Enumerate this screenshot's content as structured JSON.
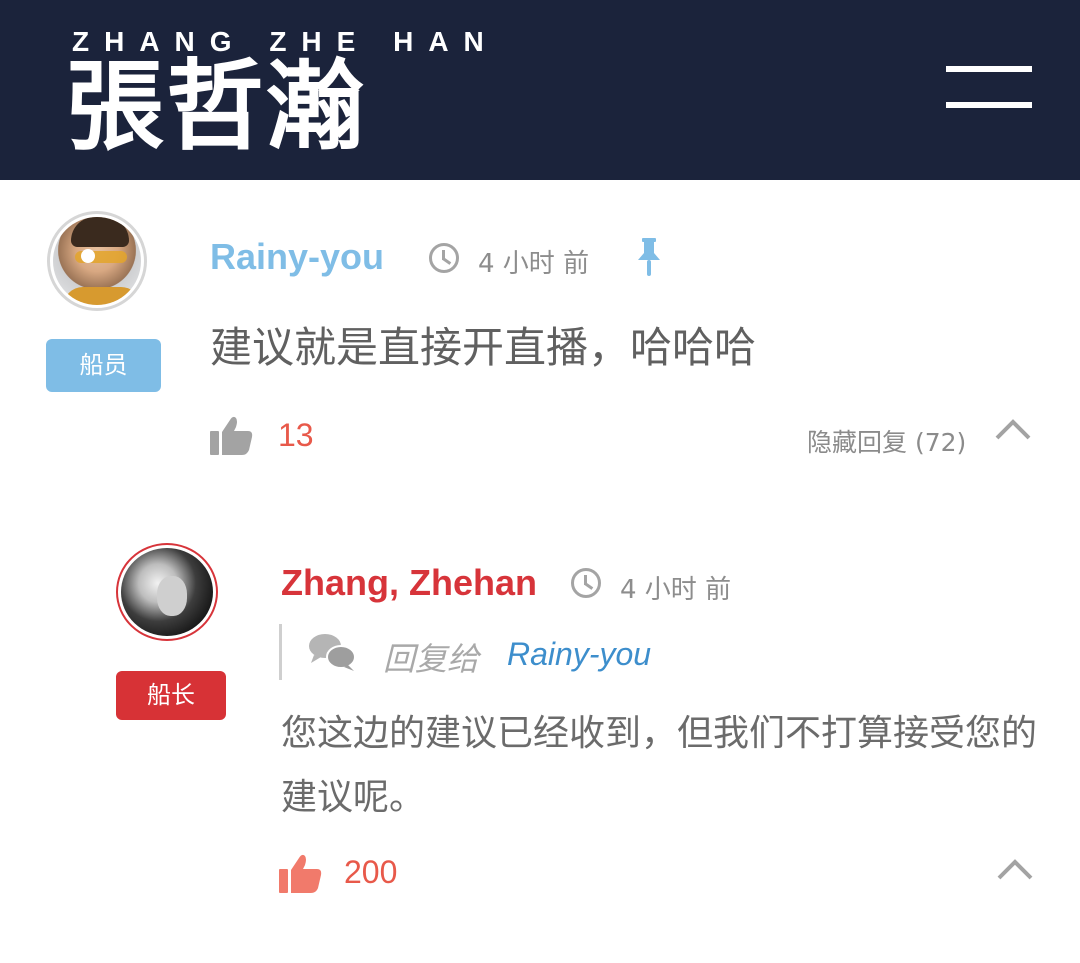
{
  "header": {
    "brand_en": "ZHANG ZHE HAN",
    "brand_zh": "張哲瀚",
    "menu_icon": "hamburger-icon"
  },
  "comment": {
    "username": "Rainy-you",
    "time": "4 小时 前",
    "badge": "船员",
    "text": "建议就是直接开直播，哈哈哈",
    "likes": "13",
    "hide_replies_label": "隐藏回复 (72)",
    "pinned": true
  },
  "reply": {
    "username": "Zhang, Zhehan",
    "time": "4 小时 前",
    "badge": "船长",
    "reply_to_label": "回复给",
    "reply_to_user": "Rainy-you",
    "text": "您这边的建议已经收到，但我们不打算接受您的建议呢。",
    "likes": "200"
  },
  "colors": {
    "header_bg": "#1b233b",
    "crew_badge": "#7fbde6",
    "captain_badge": "#d73236",
    "like_red": "#e8594a",
    "reply_link": "#3d8ecc"
  }
}
